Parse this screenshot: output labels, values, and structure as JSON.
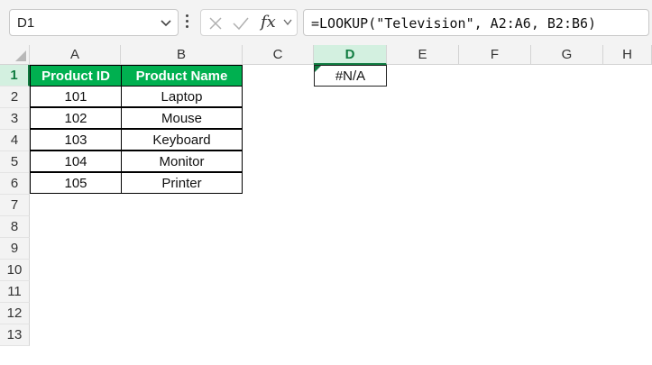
{
  "formula_bar": {
    "name_box": "D1",
    "formula": "=LOOKUP(\"Television\", A2:A6, B2:B6)",
    "fx_label": "fx",
    "icons": [
      "cancel-icon",
      "enter-check-icon",
      "insert-function-icon",
      "chevron-down-icon"
    ]
  },
  "sheet": {
    "columns": [
      "A",
      "B",
      "C",
      "D",
      "E",
      "F",
      "G",
      "H"
    ],
    "rows": [
      "1",
      "2",
      "3",
      "4",
      "5",
      "6",
      "7",
      "8",
      "9",
      "10",
      "11",
      "12",
      "13"
    ],
    "active_cell": "D1",
    "active_column": "D",
    "active_row": "1",
    "header_fill_color": "#00b050",
    "header_text_color": "#ffffff",
    "accent_color": "#107c41"
  },
  "table": {
    "headers": [
      "Product ID",
      "Product Name"
    ],
    "rows": [
      [
        "101",
        "Laptop"
      ],
      [
        "102",
        "Mouse"
      ],
      [
        "103",
        "Keyboard"
      ],
      [
        "104",
        "Monitor"
      ],
      [
        "105",
        "Printer"
      ]
    ]
  },
  "result_cell": {
    "ref": "D1",
    "value": "#N/A"
  }
}
